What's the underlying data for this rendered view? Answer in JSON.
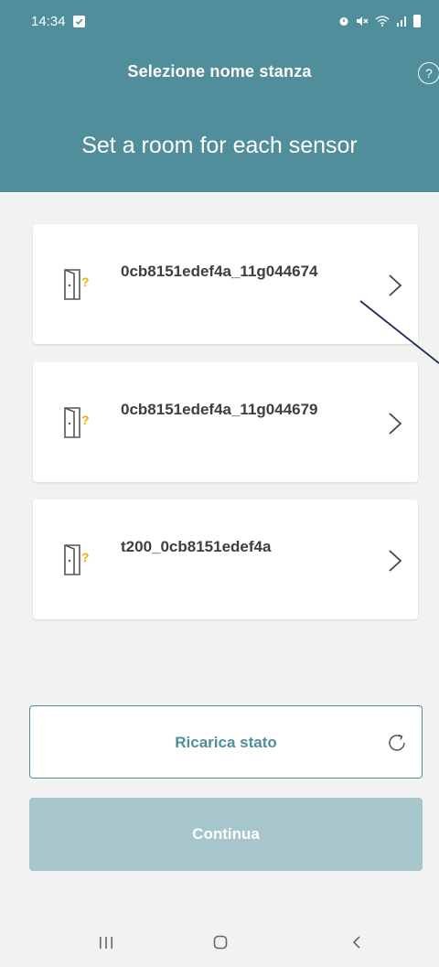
{
  "status_bar": {
    "time": "14:34"
  },
  "header": {
    "title": "Selezione nome stanza",
    "help_label": "?",
    "subtitle": "Set a room for each sensor"
  },
  "sensors": [
    {
      "label": "0cb8151edef4a_11g044674",
      "icon": "door-question-icon"
    },
    {
      "label": "0cb8151edef4a_11g044679",
      "icon": "door-question-icon"
    },
    {
      "label": "t200_0cb8151edef4a",
      "icon": "door-question-icon"
    }
  ],
  "actions": {
    "reload_label": "Ricarica stato",
    "continue_label": "Continua"
  },
  "colors": {
    "primary": "#4f8e9a",
    "disabled": "#a6c6cb",
    "accent_icon": "#f0b400",
    "background": "#f2f2f2"
  }
}
